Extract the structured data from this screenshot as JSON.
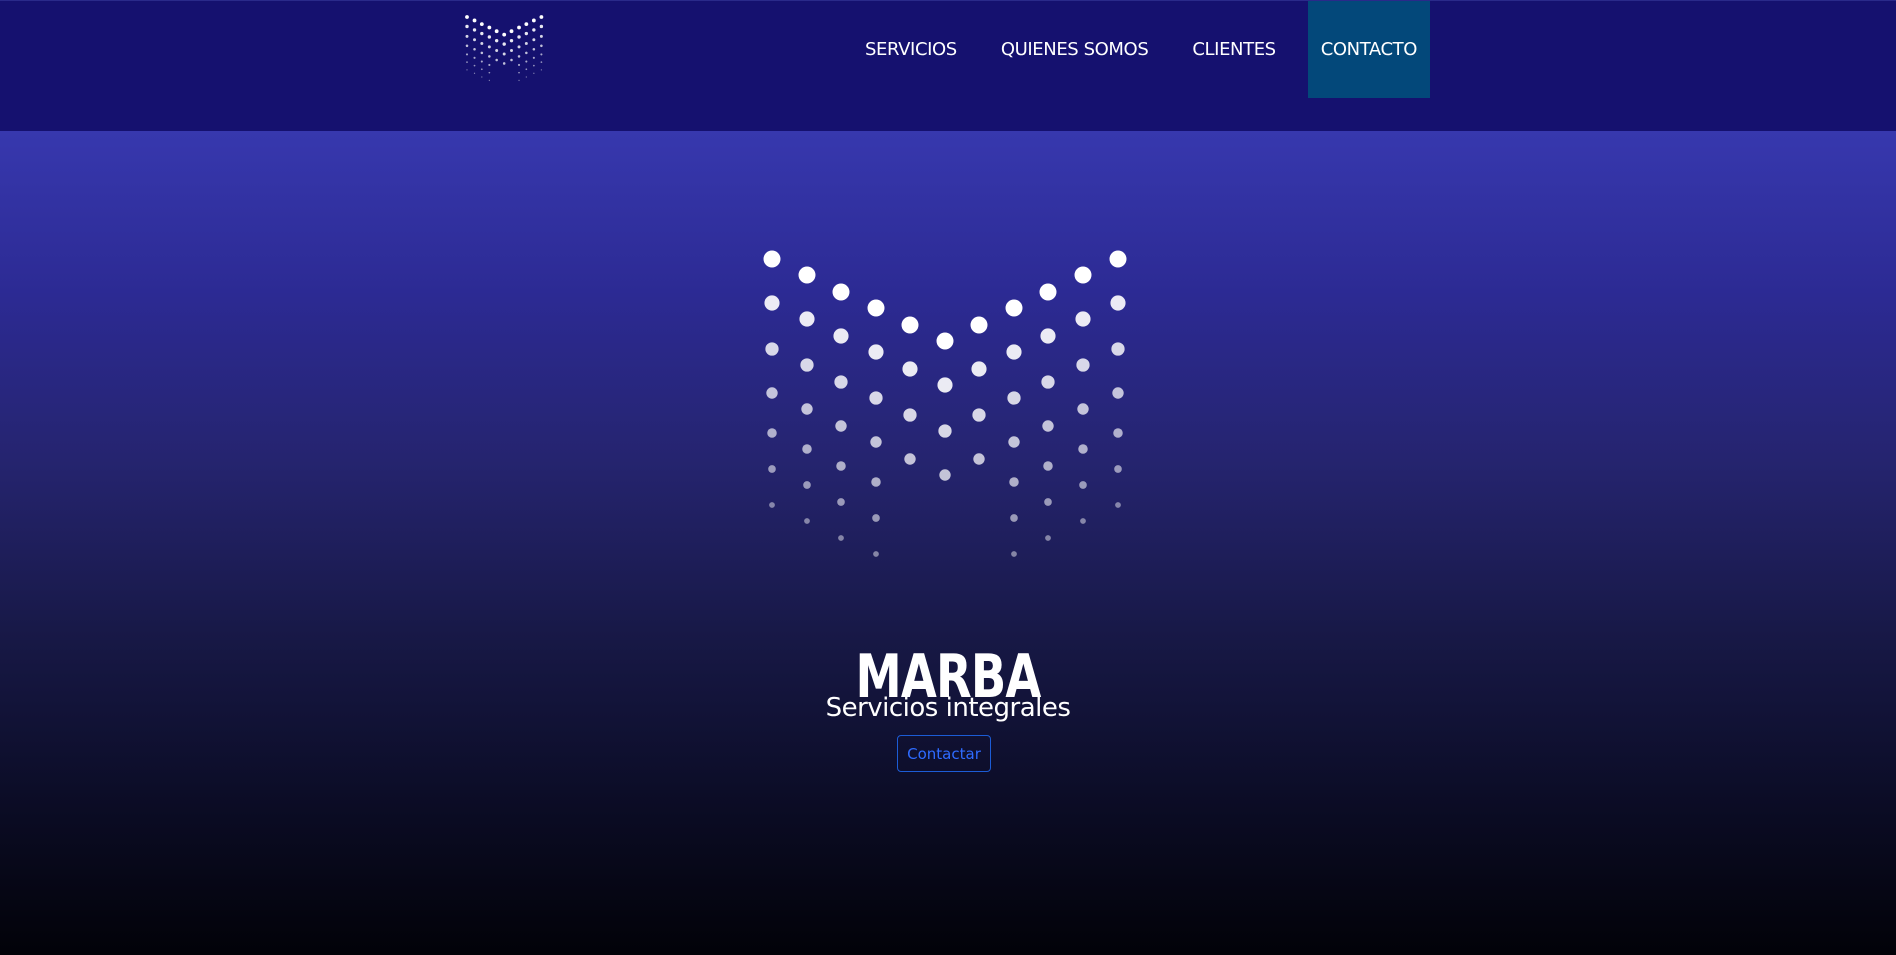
{
  "header": {
    "logo": "marba-dot-logo",
    "nav": {
      "services": "SERVICIOS",
      "about": "QUIENES SOMOS",
      "clients": "CLIENTES",
      "contact": "CONTACTO"
    },
    "active_item": "CONTACTO"
  },
  "hero": {
    "logo": "marba-dot-logo",
    "title": "MARBA",
    "subtitle": "Servicios integrales",
    "cta_label": "Contactar"
  },
  "colors": {
    "navbar_background": "#15116f",
    "active_nav_background": "#03487a",
    "hero_gradient_top": "#3738ae",
    "hero_gradient_bottom": "#020208",
    "cta_color": "#2e6bff"
  }
}
